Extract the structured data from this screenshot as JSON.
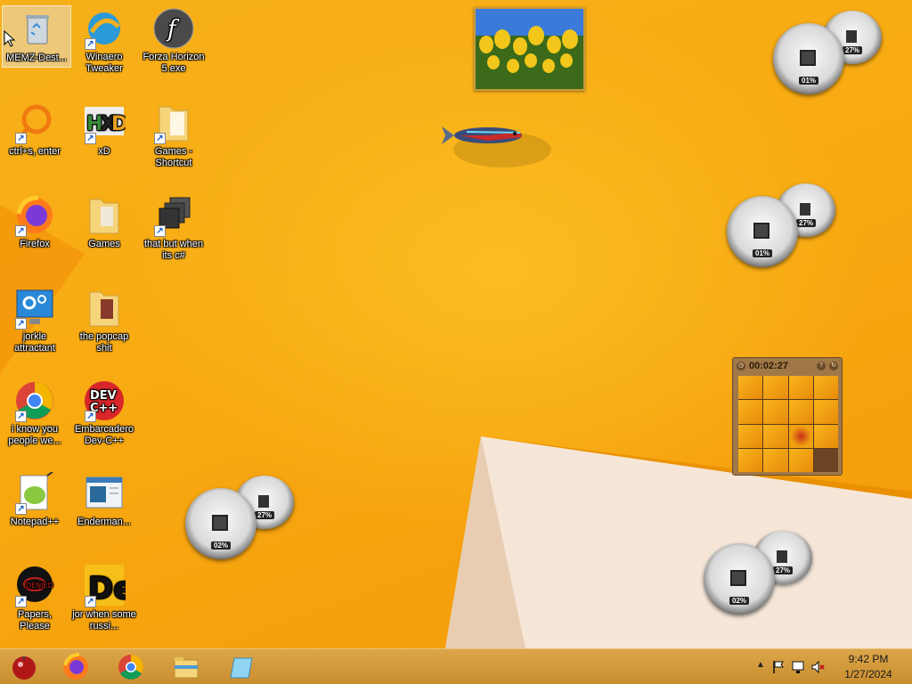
{
  "desktop": {
    "icons": [
      {
        "label": "MEMZ-Dest..."
      },
      {
        "label": "Winaero Tweaker"
      },
      {
        "label": "Forza Horizon 5.exe"
      },
      {
        "label": "ctrl+s, enter"
      },
      {
        "label": "xD"
      },
      {
        "label": "Games - Shortcut"
      },
      {
        "label": "Firefox"
      },
      {
        "label": "Games"
      },
      {
        "label": "that but when its c#"
      },
      {
        "label": "jorkle attractant"
      },
      {
        "label": "the popcap shit"
      },
      {
        "label": "i know you people we..."
      },
      {
        "label": "Embarcadero Dev-C++"
      },
      {
        "label": "Notepad++"
      },
      {
        "label": "Enderman..."
      },
      {
        "label": "Papers, Please"
      },
      {
        "label": "jor when some russi..."
      }
    ]
  },
  "gadgets": {
    "meters": [
      {
        "cpu": "01%",
        "ram": "27%"
      },
      {
        "cpu": "01%",
        "ram": "27%"
      },
      {
        "cpu": "02%",
        "ram": "27%"
      },
      {
        "cpu": "02%",
        "ram": "27%"
      }
    ],
    "puzzle": {
      "timer": "00:02:27"
    }
  },
  "taskbar": {
    "clock_time": "9:42 PM",
    "clock_date": "1/27/2024",
    "pinned": [
      "start-orb",
      "firefox",
      "chrome",
      "file-explorer",
      "unknown-app"
    ]
  },
  "colors": {
    "accent": "#f6a811",
    "taskbar": "#d39b3d"
  }
}
